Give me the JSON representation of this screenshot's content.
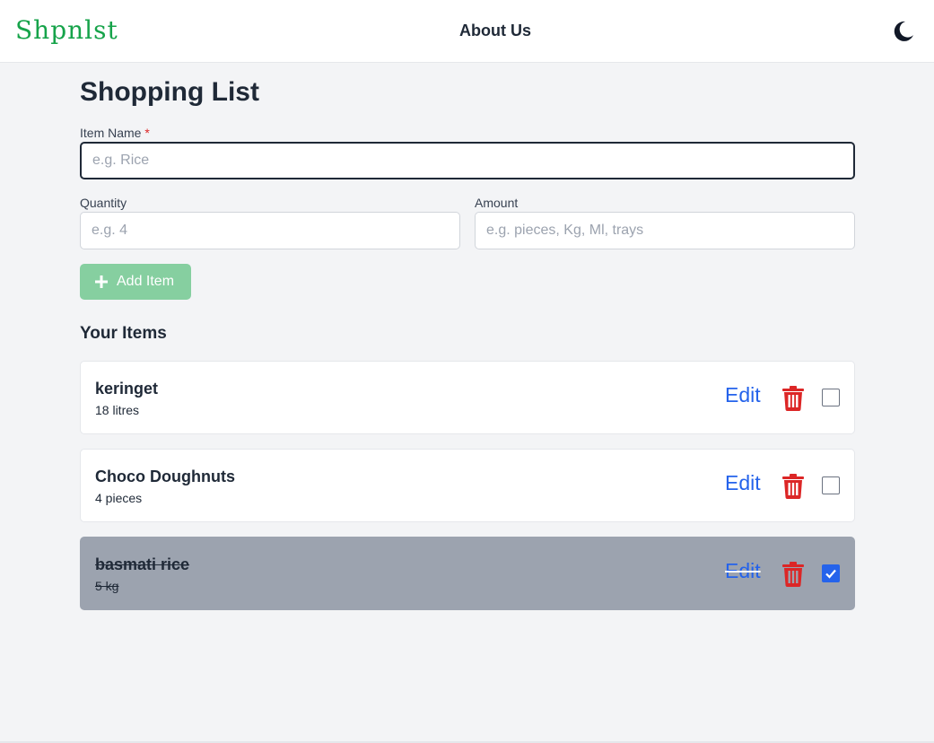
{
  "nav": {
    "logo": "Shpnlst",
    "about_link": "About Us",
    "theme_icon": "moon-icon"
  },
  "page": {
    "title": "Shopping List"
  },
  "form": {
    "item_name_label": "Item Name",
    "required_mark": "*",
    "item_name_placeholder": "e.g. Rice",
    "quantity_label": "Quantity",
    "quantity_placeholder": "e.g. 4",
    "amount_label": "Amount",
    "amount_placeholder": "e.g. pieces, Kg, Ml, trays",
    "add_button_label": "Add Item",
    "add_icon": "plus-icon"
  },
  "items_section": {
    "title": "Your Items",
    "edit_label": "Edit",
    "items": [
      {
        "name": "keringet",
        "quantity": "18 litres",
        "checked": false
      },
      {
        "name": "Choco Doughnuts",
        "quantity": "4 pieces",
        "checked": false
      },
      {
        "name": "basmati rice",
        "quantity": "5 kg",
        "checked": true
      }
    ]
  },
  "colors": {
    "brand": "#16a34a",
    "edit": "#2563eb",
    "delete": "#dc2626",
    "add_button": "#86cfa0",
    "completed_item": "#9ca3af"
  }
}
